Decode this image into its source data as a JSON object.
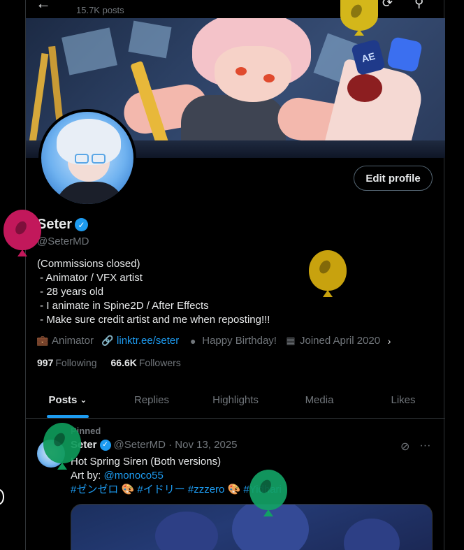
{
  "topbar": {
    "posts_count": "15.7K posts",
    "back_icon": "arrow-left-icon",
    "refresh_icon": "refresh-icon",
    "search_icon": "search-icon"
  },
  "banner": {
    "badge_text": "AE"
  },
  "profile": {
    "edit_label": "Edit profile",
    "name": "Seter",
    "verified_icon": "✓",
    "handle": "@SeterMD",
    "bio": "(Commissions closed)\n - Animator / VFX artist\n - 28 years old\n - I animate in Spine2D / After Effects\n - Make sure credit artist and me when reposting!!!",
    "meta": {
      "profession": "Animator",
      "link": "linktr.ee/seter",
      "birthday": "Happy Birthday!",
      "joined": "Joined April 2020"
    },
    "following_count": "997",
    "following_label": "Following",
    "followers_count": "66.6K",
    "followers_label": "Followers"
  },
  "tabs": [
    {
      "label": "Posts"
    },
    {
      "label": "Replies"
    },
    {
      "label": "Highlights"
    },
    {
      "label": "Media"
    },
    {
      "label": "Likes"
    }
  ],
  "post": {
    "pinned_label": "Pinned",
    "author": "Seter",
    "meta": "@SeterMD · Nov 13, 2025",
    "line1": "Hot Spring Siren (Both versions)",
    "line2_prefix": "Art by: ",
    "line2_link": "@monoco55",
    "hashtags": "#ゼンゼロ 🎨 #イドリー #zzzero 🎨 #Yidhari"
  },
  "colors": {
    "accent": "#1d9bf0",
    "muted": "#71767b",
    "text": "#e7e9ea",
    "balloon_yellow_top": "#d4b71a",
    "balloon_magenta": "#c2185b",
    "balloon_olive": "#c8a20e",
    "balloon_green_left": "#0e9a5a",
    "balloon_green_right": "#12a165"
  }
}
